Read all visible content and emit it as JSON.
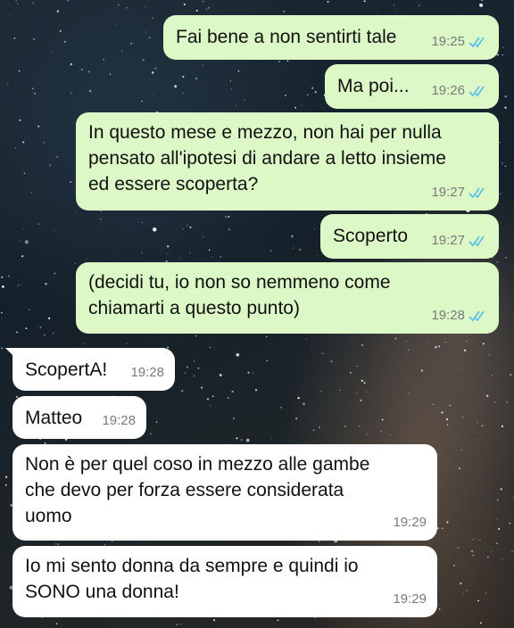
{
  "messages": [
    {
      "side": "out",
      "text": "Fai bene a non sentirti tale",
      "time": "19:25",
      "ticks": "double-check-icon"
    },
    {
      "side": "out",
      "text": "Ma poi...",
      "time": "19:26",
      "ticks": "double-check-icon"
    },
    {
      "side": "out",
      "text": "In questo mese e mezzo, non hai per nulla\npensato all'ipotesi di andare a letto insieme\ned essere scoperta?",
      "time": "19:27",
      "ticks": "double-check-icon"
    },
    {
      "side": "out",
      "text": "Scoperto",
      "time": "19:27",
      "ticks": "double-check-icon"
    },
    {
      "side": "out",
      "text": "(decidi tu, io non so nemmeno come\nchiamarti a questo punto)",
      "time": "19:28",
      "ticks": "double-check-icon"
    },
    {
      "side": "in",
      "text": "ScopertA!",
      "time": "19:28"
    },
    {
      "side": "in",
      "text": "Matteo",
      "time": "19:28"
    },
    {
      "side": "in",
      "text": "Non è per quel coso in mezzo alle gambe\nche devo per forza essere considerata\nuomo",
      "time": "19:29"
    },
    {
      "side": "in",
      "text": "Io mi sento donna da sempre e quindi io\nSONO una donna!",
      "time": "19:29"
    }
  ],
  "colors": {
    "outgoing": "#dcf8c6",
    "incoming": "#ffffff",
    "read_ticks": "#53bdeb",
    "time": "#7a7a7a"
  }
}
